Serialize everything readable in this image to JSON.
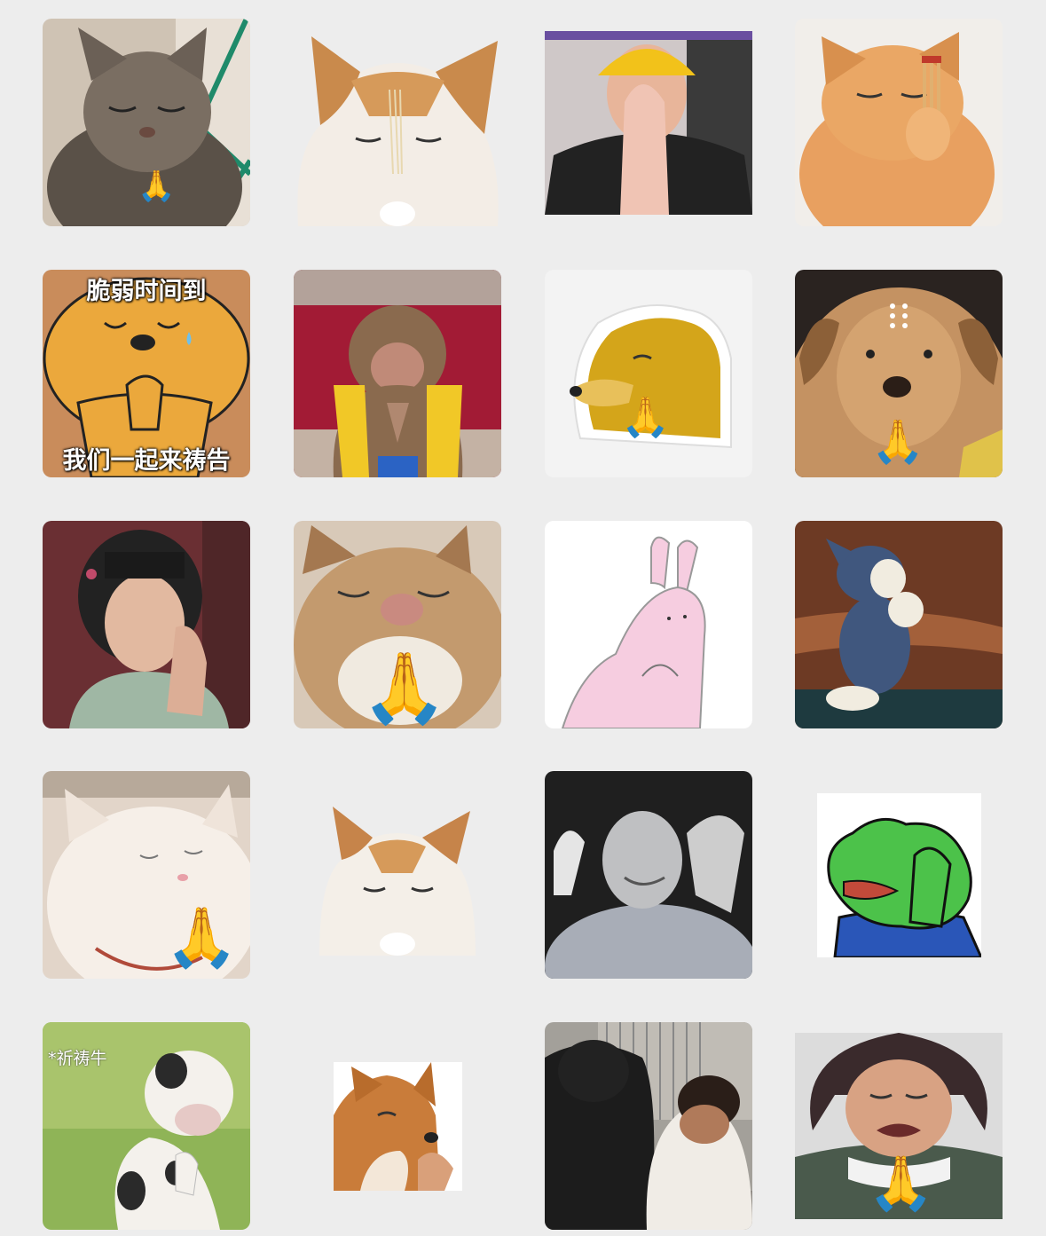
{
  "grid": {
    "rows": 5,
    "columns": 4,
    "background": "#ededed"
  },
  "stickers": [
    {
      "subject": "tabby cat praying",
      "icon": "praying-hands-icon"
    },
    {
      "subject": "orange and white cat with incense",
      "icon": "incense-icon"
    },
    {
      "subject": "man in yellow hard hat praying",
      "icon": ""
    },
    {
      "subject": "orange cat holding incense sticks",
      "icon": "incense-icon"
    },
    {
      "subject": "cartoon bear praying",
      "caption_top": "脆弱时间到",
      "caption_bottom": "我们一起来祷告"
    },
    {
      "subject": "monkey in yellow vest praying",
      "icon": ""
    },
    {
      "subject": "shiba doge praying",
      "icon": "praying-hands-icon"
    },
    {
      "subject": "dog with forehead dots praying",
      "icon": "praying-hands-icon"
    },
    {
      "subject": "woman in costume praying",
      "icon": ""
    },
    {
      "subject": "cat with eyes closed",
      "icon": "praying-hands-icon"
    },
    {
      "subject": "pink rabbit praying",
      "icon": ""
    },
    {
      "subject": "cartoon cat praying on knees",
      "icon": ""
    },
    {
      "subject": "white fluffy cat",
      "icon": "praying-hands-icon"
    },
    {
      "subject": "orange and white cat praying",
      "icon": ""
    },
    {
      "subject": "man clapping hands blurred",
      "icon": ""
    },
    {
      "subject": "green frog praying",
      "icon": ""
    },
    {
      "subject": "cartoon cow praying",
      "caption_corner": "*祈祷牛"
    },
    {
      "subject": "shiba dog praying",
      "icon": ""
    },
    {
      "subject": "two people kneeling",
      "icon": ""
    },
    {
      "subject": "man in fur hat praying",
      "icon": "praying-hands-icon"
    }
  ],
  "emoji": {
    "praying_hands": "🙏"
  }
}
